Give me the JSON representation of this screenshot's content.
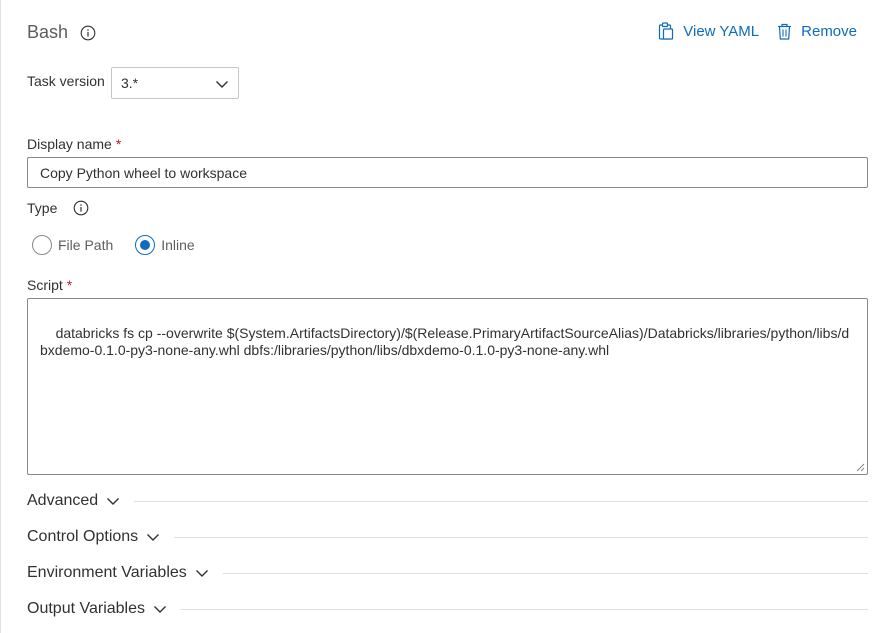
{
  "header": {
    "title": "Bash",
    "view_yaml_label": "View YAML",
    "remove_label": "Remove"
  },
  "task_version": {
    "label": "Task version",
    "value": "3.*"
  },
  "display_name": {
    "label": "Display name",
    "required_mark": "*",
    "value": "Copy Python wheel to workspace"
  },
  "type": {
    "label": "Type",
    "options": [
      {
        "label": "File Path",
        "selected": false
      },
      {
        "label": "Inline",
        "selected": true
      }
    ]
  },
  "script": {
    "label": "Script",
    "required_mark": "*",
    "value": "databricks fs cp --overwrite $(System.ArtifactsDirectory)/$(Release.PrimaryArtifactSourceAlias)/Databricks/libraries/python/libs/dbxdemo-0.1.0-py3-none-any.whl dbfs:/libraries/python/libs/dbxdemo-0.1.0-py3-none-any.whl"
  },
  "sections": [
    {
      "title": "Advanced"
    },
    {
      "title": "Control Options"
    },
    {
      "title": "Environment Variables"
    },
    {
      "title": "Output Variables"
    }
  ],
  "colors": {
    "accent": "#0f6cbd",
    "required": "#a4262c",
    "border": "#8a8886"
  },
  "icons": {
    "title_info": "info-icon",
    "view_yaml": "clipboard-icon",
    "remove": "trash-icon",
    "select": "chevron-down-icon"
  }
}
